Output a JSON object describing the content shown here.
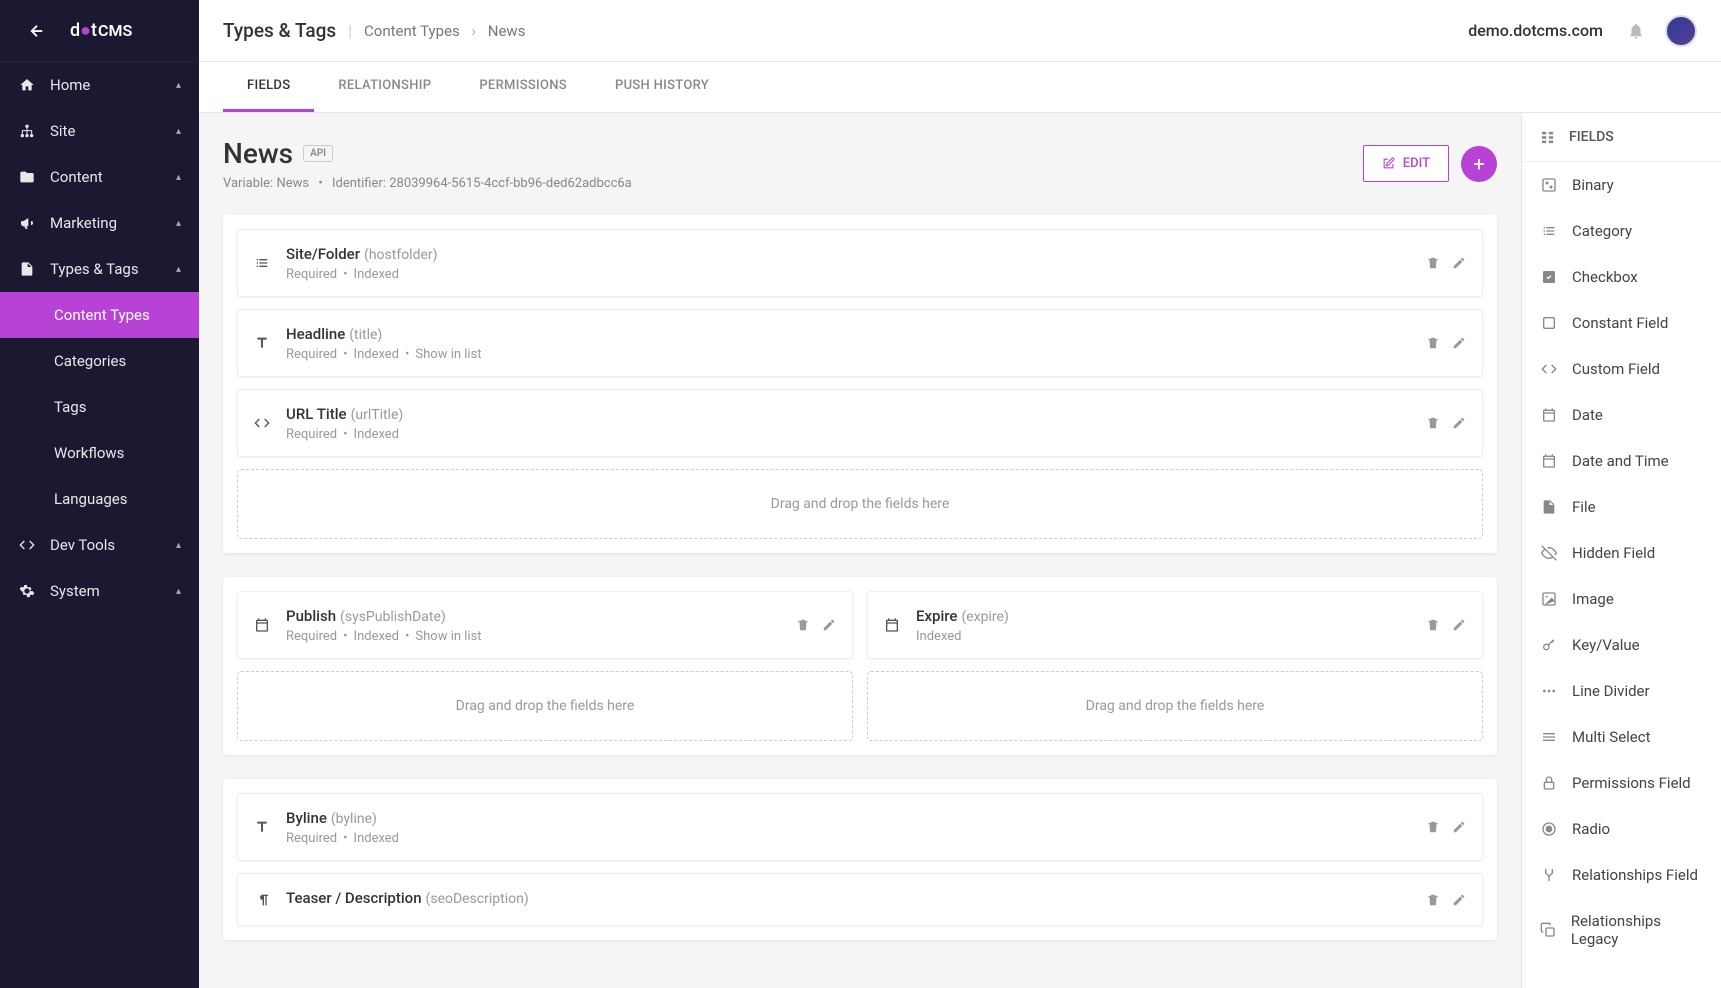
{
  "header": {
    "section": "Types & Tags",
    "breadcrumb": [
      "Content Types",
      "News"
    ],
    "domain": "demo.dotcms.com"
  },
  "sidebar": {
    "items": [
      {
        "label": "Home",
        "icon": "home"
      },
      {
        "label": "Site",
        "icon": "sitemap"
      },
      {
        "label": "Content",
        "icon": "folder"
      },
      {
        "label": "Marketing",
        "icon": "bullhorn"
      },
      {
        "label": "Types & Tags",
        "icon": "file",
        "expanded": true,
        "children": [
          {
            "label": "Content Types",
            "active": true
          },
          {
            "label": "Categories"
          },
          {
            "label": "Tags"
          },
          {
            "label": "Workflows"
          },
          {
            "label": "Languages"
          }
        ]
      },
      {
        "label": "Dev Tools",
        "icon": "code"
      },
      {
        "label": "System",
        "icon": "gear"
      }
    ]
  },
  "tabs": {
    "items": [
      {
        "label": "FIELDS",
        "active": true
      },
      {
        "label": "RELATIONSHIP"
      },
      {
        "label": "PERMISSIONS"
      },
      {
        "label": "PUSH HISTORY"
      }
    ]
  },
  "content_header": {
    "title": "News",
    "badge": "API",
    "variable_label": "Variable:",
    "variable": "News",
    "identifier_label": "Identifier:",
    "identifier": "28039964-5615-4ccf-bb96-ded62adbcc6a",
    "edit_label": "EDIT"
  },
  "dropzone_text": "Drag and drop the fields here",
  "field_groups": [
    {
      "columns": [
        {
          "fields": [
            {
              "icon": "list",
              "title": "Site/Folder",
              "var": "(hostfolder)",
              "meta": [
                "Required",
                "Indexed"
              ]
            },
            {
              "icon": "text",
              "title": "Headline",
              "var": "(title)",
              "meta": [
                "Required",
                "Indexed",
                "Show in list"
              ]
            },
            {
              "icon": "code",
              "title": "URL Title",
              "var": "(urlTitle)",
              "meta": [
                "Required",
                "Indexed"
              ]
            }
          ],
          "dropzone": true
        }
      ]
    },
    {
      "columns": [
        {
          "fields": [
            {
              "icon": "calendar",
              "title": "Publish",
              "var": "(sysPublishDate)",
              "meta": [
                "Required",
                "Indexed",
                "Show in list"
              ]
            }
          ],
          "dropzone": true
        },
        {
          "fields": [
            {
              "icon": "calendar",
              "title": "Expire",
              "var": "(expire)",
              "meta": [
                "Indexed"
              ]
            }
          ],
          "dropzone": true
        }
      ]
    },
    {
      "columns": [
        {
          "fields": [
            {
              "icon": "text",
              "title": "Byline",
              "var": "(byline)",
              "meta": [
                "Required",
                "Indexed"
              ]
            },
            {
              "icon": "paragraph",
              "title": "Teaser / Description",
              "var": "(seoDescription)",
              "meta": []
            }
          ]
        }
      ]
    }
  ],
  "right_panel": {
    "header": "FIELDS",
    "items": [
      {
        "label": "Binary",
        "icon": "binary"
      },
      {
        "label": "Category",
        "icon": "list"
      },
      {
        "label": "Checkbox",
        "icon": "checkbox"
      },
      {
        "label": "Constant Field",
        "icon": "square"
      },
      {
        "label": "Custom Field",
        "icon": "code"
      },
      {
        "label": "Date",
        "icon": "calendar"
      },
      {
        "label": "Date and Time",
        "icon": "calendar"
      },
      {
        "label": "File",
        "icon": "file"
      },
      {
        "label": "Hidden Field",
        "icon": "eye-off"
      },
      {
        "label": "Image",
        "icon": "image"
      },
      {
        "label": "Key/Value",
        "icon": "key"
      },
      {
        "label": "Line Divider",
        "icon": "dots"
      },
      {
        "label": "Multi Select",
        "icon": "lines"
      },
      {
        "label": "Permissions Field",
        "icon": "lock"
      },
      {
        "label": "Radio",
        "icon": "radio"
      },
      {
        "label": "Relationships Field",
        "icon": "merge"
      },
      {
        "label": "Relationships Legacy",
        "icon": "copy"
      }
    ]
  }
}
